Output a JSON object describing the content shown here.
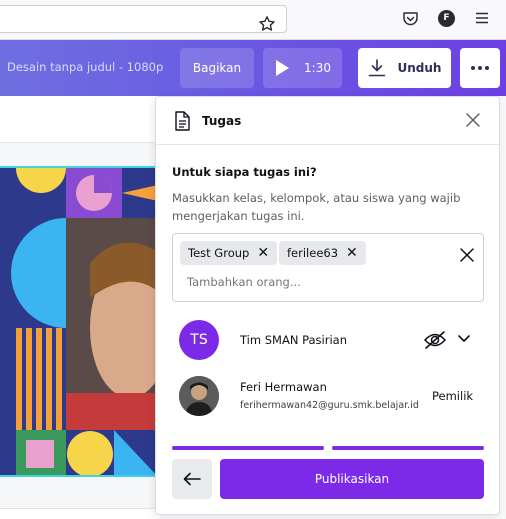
{
  "browser": {
    "icons": [
      "star-icon",
      "pocket-icon",
      "account-icon",
      "hamburger-icon"
    ],
    "account_initial": "F"
  },
  "header": {
    "doc_title": "Desain tanpa judul - 1080p",
    "share_label": "Bagikan",
    "play_duration": "1:30",
    "download_label": "Unduh"
  },
  "panel": {
    "title": "Tugas",
    "question": "Untuk siapa tugas ini?",
    "help_text": "Masukkan kelas, kelompok, atau siswa yang wajib mengerjakan tugas ini.",
    "chips": [
      "Test Group",
      "ferilee63"
    ],
    "input_placeholder": "Tambahkan orang...",
    "members": [
      {
        "initials": "TS",
        "name": "Tim SMAN Pasirian",
        "role": ""
      },
      {
        "initials": "",
        "name": "Feri Hermawan",
        "email": "ferihermawan42@guru.smk.belajar.id",
        "role": "Pemilik"
      }
    ],
    "publish_label": "Publikasikan"
  },
  "colors": {
    "brand_purple": "#7d2ae8",
    "header_gradient_start": "#6f6fe0",
    "header_gradient_end": "#6d3fe3",
    "canvas_border": "#3fd3e2"
  }
}
